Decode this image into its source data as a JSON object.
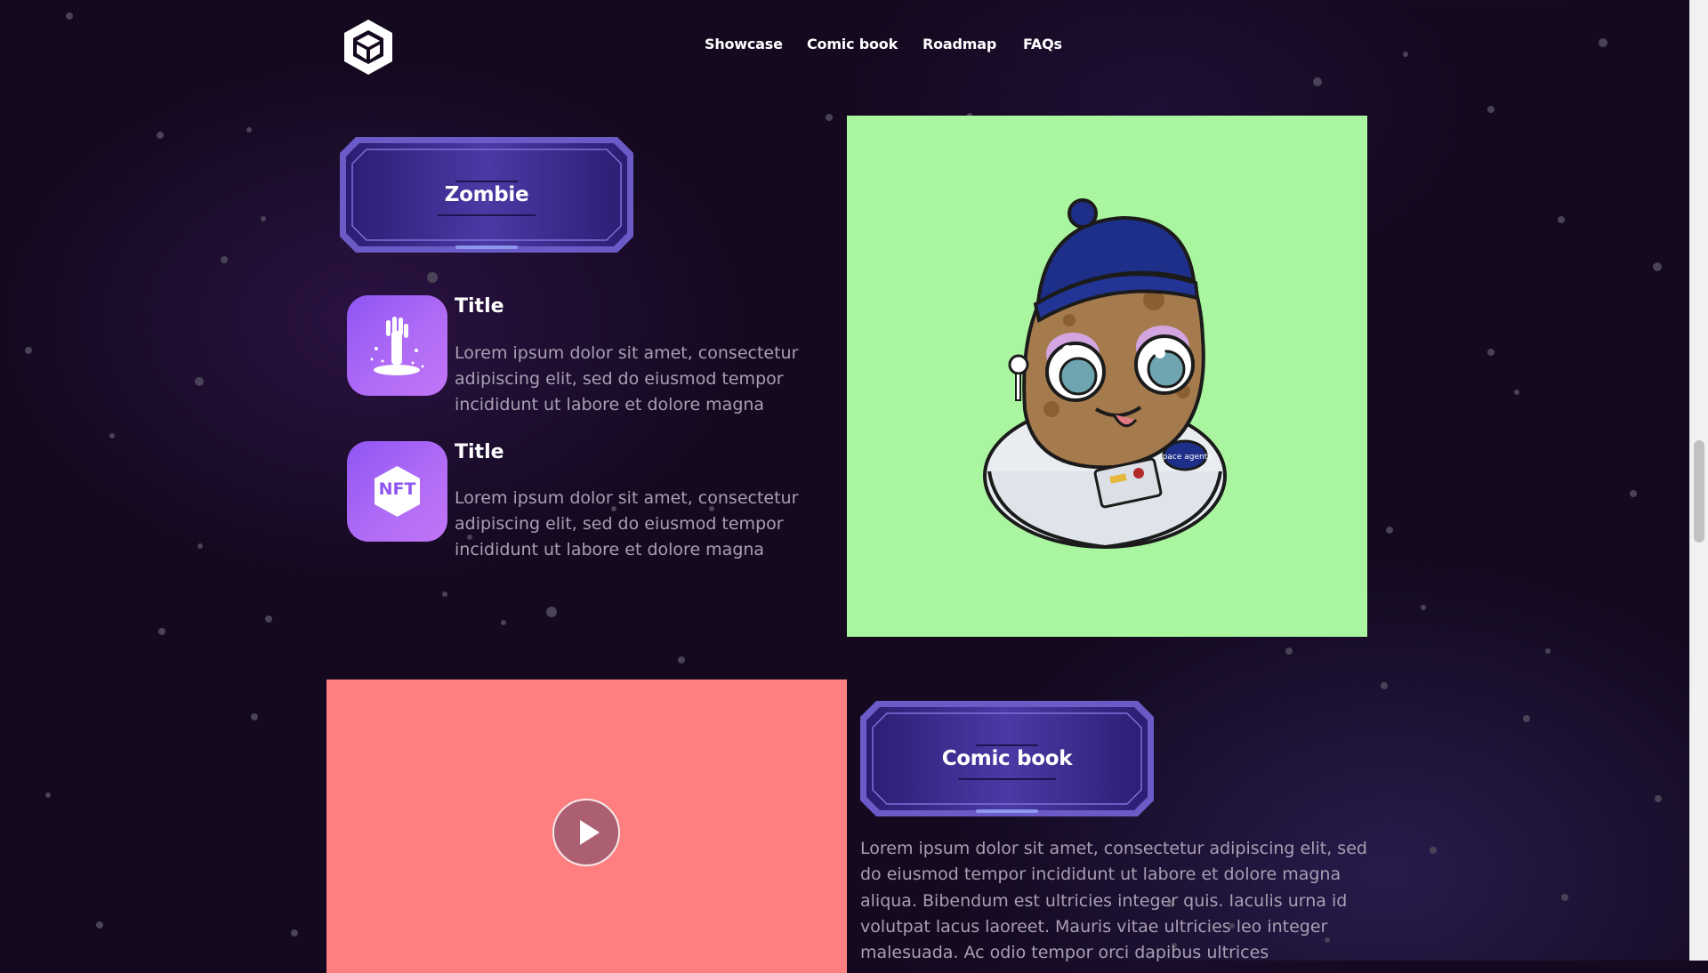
{
  "nav": {
    "logo_icon": "cube-logo-icon",
    "items": [
      {
        "label": "Showcase"
      },
      {
        "label": "Comic book"
      },
      {
        "label": "Roadmap"
      },
      {
        "label": "FAQs"
      }
    ]
  },
  "zombie_section": {
    "badge_label": "Zombie",
    "features": [
      {
        "icon": "zombie-hand-icon",
        "title": "Title",
        "text": "Lorem ipsum dolor sit amet, consectetur adipiscing elit, sed do eiusmod tempor incididunt ut labore et dolore magna"
      },
      {
        "icon": "nft-hexagon-icon",
        "icon_text": "NFT",
        "title": "Title",
        "text": "Lorem ipsum dolor sit amet, consectetur adipiscing elit, sed do eiusmod tempor incididunt ut labore et dolore magna"
      }
    ],
    "image_bg": "#aaf59f",
    "character_patch_text": "space agents"
  },
  "comic_section": {
    "badge_label": "Comic book",
    "video_bg": "#ff7f81",
    "text": "Lorem ipsum dolor sit amet, consectetur adipiscing elit, sed do eiusmod tempor incididunt ut labore et dolore magna aliqua. Bibendum est ultricies integer quis. Iaculis urna id volutpat lacus laoreet. Mauris vitae ultricies leo integer malesuada. Ac odio tempor orci dapibus ultrices"
  },
  "colors": {
    "background": "#14091f",
    "accent_purple": "#8f55f3",
    "badge_frame": "#6a5bc6",
    "body_text": "#a99fb3"
  }
}
